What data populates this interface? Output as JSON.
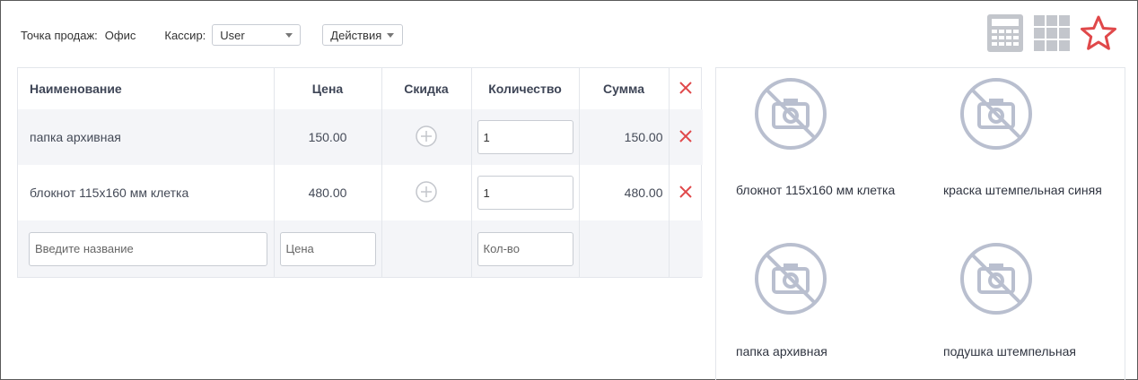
{
  "toolbar": {
    "point_of_sale_label": "Точка продаж:",
    "point_of_sale_value": "Офис",
    "cashier_label": "Кассир:",
    "cashier_value": "User",
    "actions_label": "Действия"
  },
  "icons": {
    "calculator": "calculator-icon",
    "grid": "grid-icon",
    "star": "star-icon",
    "star_color": "#e0484a",
    "delete_color": "#e0484a",
    "icon_gray": "#c3c6cc"
  },
  "table": {
    "headers": {
      "name": "Наименование",
      "price": "Цена",
      "discount": "Скидка",
      "quantity": "Количество",
      "sum": "Сумма"
    },
    "rows": [
      {
        "name": "папка архивная",
        "price": "150.00",
        "quantity": "1",
        "sum": "150.00"
      },
      {
        "name": "блокнот 115х160 мм клетка",
        "price": "480.00",
        "quantity": "1",
        "sum": "480.00"
      }
    ],
    "new_row": {
      "name_placeholder": "Введите название",
      "price_placeholder": "Цена",
      "quantity_placeholder": "Кол-во"
    }
  },
  "products": [
    {
      "name": "блокнот 115х160 мм клетка"
    },
    {
      "name": "краска штемпельная синяя"
    },
    {
      "name": "папка архивная"
    },
    {
      "name": "подушка штемпельная"
    }
  ]
}
